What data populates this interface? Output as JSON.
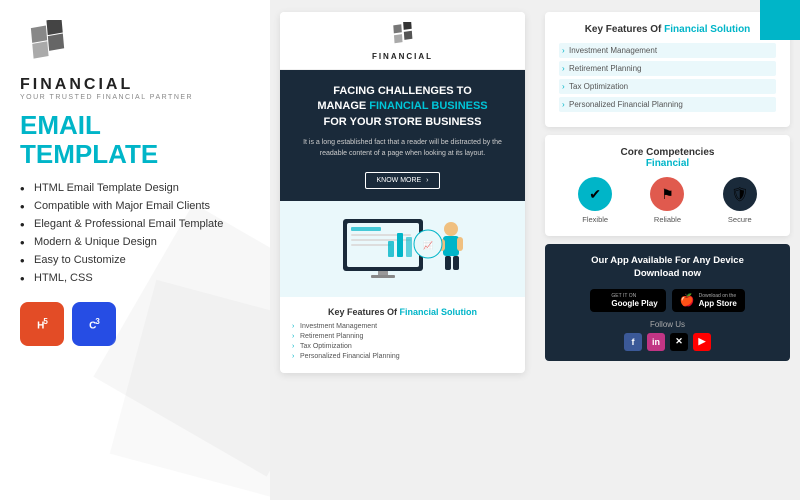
{
  "left": {
    "logo_name": "FINANCIAL",
    "logo_tagline": "YOUR TRUSTED FINANCIAL PARTNER",
    "title_line1": "EMAIL",
    "title_line2": "TEMPLATE",
    "features": [
      "HTML Email Template Design",
      "Compatible with Major Email Clients",
      "Elegant & Professional Email Template",
      "Modern & Unique Design",
      "Easy to Customize",
      "HTML, CSS"
    ],
    "badge_html": "5",
    "badge_css": "3"
  },
  "middle": {
    "logo_name": "FINANCIAL",
    "hero_title_line1": "FACING CHALLENGES TO",
    "hero_title_line2": "MANAGE",
    "hero_title_highlight": "FINANCIAL BUSINESS",
    "hero_title_line3": "FOR YOUR",
    "hero_title_strong": "STORE BUSINESS",
    "hero_desc": "It is a long established fact that a reader will be distracted by the readable content of a page when looking at its layout.",
    "hero_btn": "KNOW MORE",
    "features_title": "Key Features Of",
    "features_accent": "Financial Solution",
    "features": [
      "Investment Management",
      "Retirement Planning",
      "Tax Optimization",
      "Personalized Financial Planning"
    ]
  },
  "right": {
    "kf_title": "Key Features Of",
    "kf_accent": "Financial Solution",
    "kf_features": [
      "Investment Management",
      "Retirement Planning",
      "Tax Optimization",
      "Personalized Financial Planning"
    ],
    "core_title": "Core Competencies",
    "core_accent": "Financial",
    "core_icons": [
      {
        "label": "Flexible",
        "color": "teal"
      },
      {
        "label": "Reliable",
        "color": "coral"
      },
      {
        "label": "Secure",
        "color": "dark"
      }
    ],
    "app_title_line1": "Our App Available For Any Device",
    "app_title_line2": "Download now",
    "google_top": "GET IT ON",
    "google_bottom": "Google Play",
    "apple_top": "Download on the",
    "apple_bottom": "App Store",
    "follow_label": "Follow Us",
    "social": [
      "f",
      "in",
      "✕",
      "▶"
    ]
  }
}
